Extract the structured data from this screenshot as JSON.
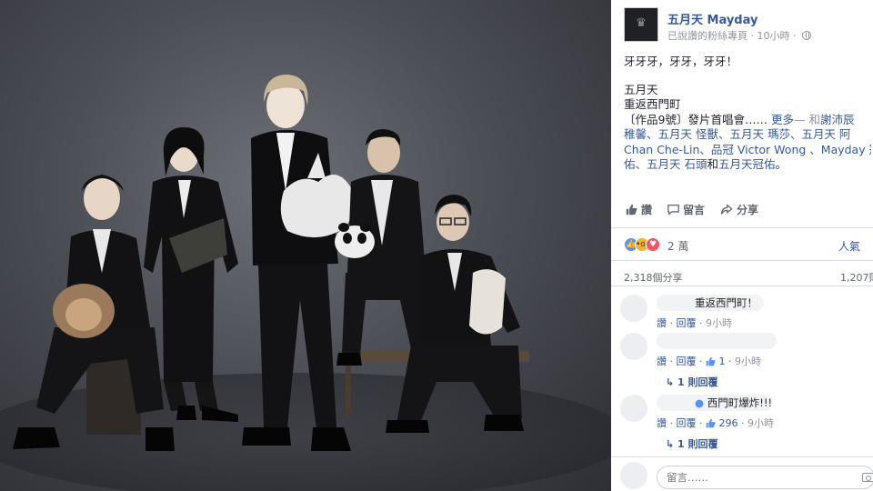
{
  "page": {
    "name": "五月天 Mayday",
    "verified_label": "已說讚的粉絲專頁",
    "time": "10小時",
    "icons": {
      "privacy": "globe-icon",
      "avatar": "mayday-logo"
    }
  },
  "post": {
    "line1": "牙牙牙，牙牙，牙牙！",
    "line2": "五月天",
    "line3": "重返西門町",
    "line4_text": "〔作品9號〕發片首唱會……",
    "line4_more": "更多",
    "line4_sep": "— 和",
    "line4_tag": "謝沛辰",
    "line5": "稚馨、五月天 怪獸、五月天 瑪莎、五月天 阿",
    "line6": "Chan Che-Lin、品冠 Victor Wong 、Mayday 冠",
    "line7_tags": "佑、五月天 石頭",
    "line7_and": "和",
    "line7_last": "五月天冠佑",
    "line7_end": "。"
  },
  "actions": {
    "like": "讚",
    "comment": "留言",
    "share": "分享"
  },
  "reactions": {
    "count": "2 萬",
    "top_label": "人氣",
    "shares": "2,318個分享",
    "comments_count": "1,207則"
  },
  "comments": [
    {
      "text": "重返西門町！",
      "like": "讚",
      "reply": "回覆",
      "likes": "",
      "time": "9小時"
    },
    {
      "text": "",
      "like": "讚",
      "reply": "回覆",
      "likes": "1",
      "time": "9小時",
      "replies": "1 則回覆"
    },
    {
      "text": "西門町爆炸!!!",
      "like": "讚",
      "reply": "回覆",
      "likes": "296",
      "time": "9小時",
      "replies": "1 則回覆"
    }
  ],
  "comment_box": {
    "placeholder": "留言……"
  },
  "colors": {
    "link": "#365899",
    "meta": "#90949c",
    "like_blue": "#5890ff",
    "love_red": "#f25268",
    "wow_yellow": "#f7b125"
  }
}
